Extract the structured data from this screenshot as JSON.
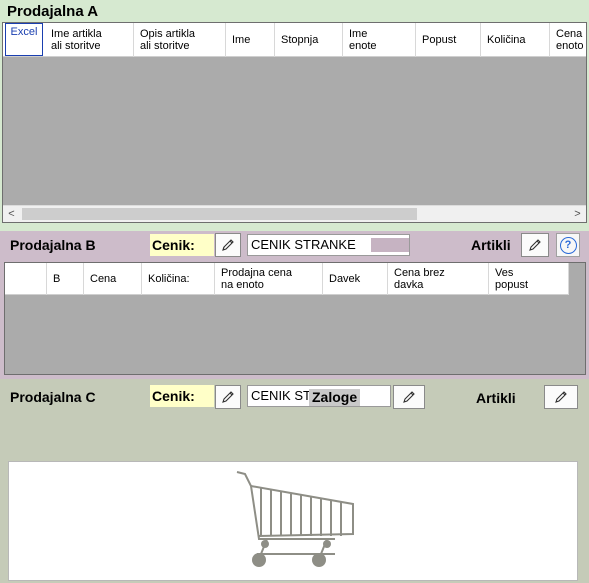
{
  "panel_a": {
    "title": "Prodajalna A",
    "columns": [
      "Excel",
      "Ime artikla\nali storitve",
      "Opis artikla\nali storitve",
      "Ime",
      "Stopnja",
      "Ime\nenote",
      "Popust",
      "Količina",
      "Cena n\nenoto"
    ],
    "scroll_left": "<",
    "scroll_right": ">"
  },
  "panel_b": {
    "title": "Prodajalna B",
    "cenik_label": "Cenik:",
    "cenik_value": "CENIK STRANKE",
    "artikli_label": "Artikli",
    "help_label": "?",
    "columns": [
      "",
      "B",
      "Cena",
      "Količina:",
      "Prodajna cena\nna enoto",
      "Davek",
      "Cena brez\ndavka",
      "Ves\npopust"
    ]
  },
  "panel_c": {
    "title": "Prodajalna C",
    "cenik_label": "Cenik:",
    "cenik_value": "CENIK ST",
    "zaloge_label": "Zaloge",
    "artikli_label": "Artikli"
  },
  "icons": {
    "pencil": "pencil-icon",
    "help": "help-icon",
    "cart": "shopping-cart-icon"
  },
  "colors": {
    "panel_a_bg": "#d6e9d0",
    "panel_b_bg": "#cdbcca",
    "panel_c_bg": "#c5cbb8",
    "grid_empty": "#ababab",
    "cenik_label_bg": "#ffffc8",
    "excel_accent": "#1a3fb0"
  }
}
